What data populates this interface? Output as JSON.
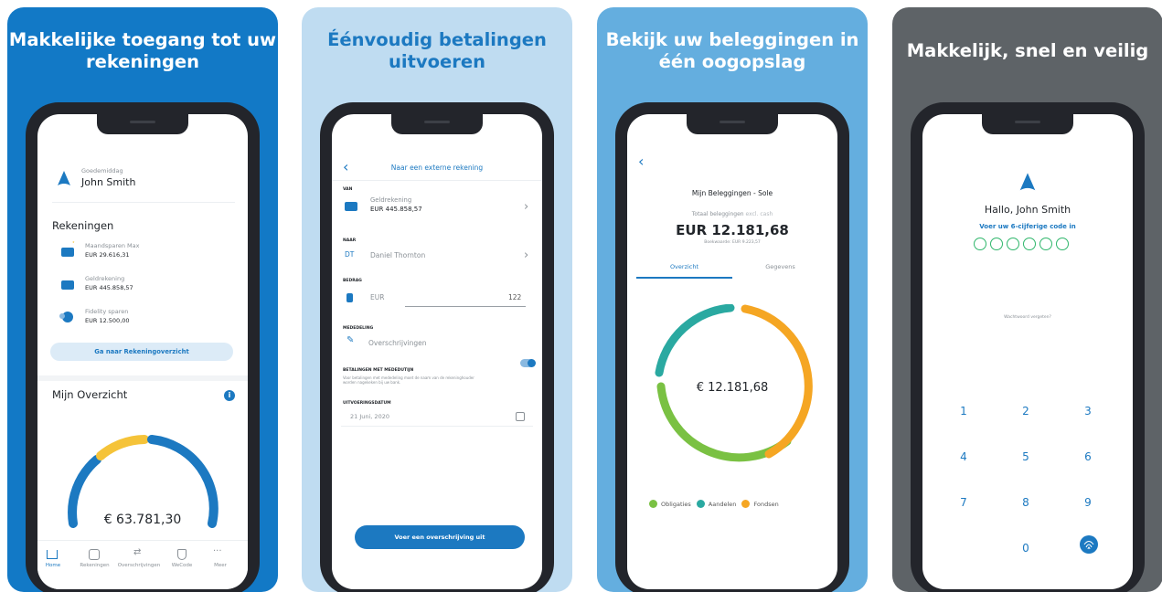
{
  "panel1": {
    "headline": "Makkelijke toegang tot uw rekeningen",
    "greeting": "Goedemiddag",
    "user_name": "John Smith",
    "accounts_title": "Rekeningen",
    "accounts": [
      {
        "name": "Maandsparen Max",
        "amount": "EUR 29.616,31"
      },
      {
        "name": "Geldrekening",
        "amount": "EUR 445.858,57"
      },
      {
        "name": "Fidelity sparen",
        "amount": "EUR 12.500,00"
      }
    ],
    "overview_button": "Ga naar Rekeningoverzicht",
    "overview_title": "Mijn Overzicht",
    "total": "€ 63.781,30",
    "tabs": [
      "Home",
      "Rekeningen",
      "Overschrijvingen",
      "WeCode",
      "Meer"
    ],
    "colors": {
      "panel": "#1279c6",
      "gauge_yellow": "#f5c339",
      "gauge_blue": "#1c79c1"
    }
  },
  "panel2": {
    "headline": "Éénvoudig betalingen uitvoeren",
    "nav_title": "Naar een externe rekening",
    "from_label": "VAN",
    "from_account": "Geldrekening",
    "from_amount": "EUR 445.858,57",
    "to_label": "NAAR",
    "to_initials": "DT",
    "to_name": "Daniel Thornton",
    "amount_label": "BEDRAG",
    "currency": "EUR",
    "amount_value": "122",
    "message_label": "MEDEDELING",
    "message_value": "Overschrijvingen",
    "toggle_label": "BETALINGEN MET MEDEDUTIJN",
    "toggle_desc": "Voor betalingen met mededeling moet de naam van de rekeninghouder worden nagekeken bij uw bank.",
    "date_label": "UITVOERINGSDATUM",
    "date_value": "21 Juni, 2020",
    "submit": "Voer een overschrijving uit"
  },
  "panel3": {
    "headline": "Bekijk uw beleggingen in één oogopslag",
    "title": "Mijn Beleggingen - Sole",
    "total_label": "Totaal beleggingen",
    "total_label_suffix": "excl. cash",
    "total_value": "EUR  12.181,68",
    "book_value": "Boekwaarde: EUR  9.223,57",
    "tabs": [
      "Overzicht",
      "Gegevens"
    ],
    "donut_center": "€ 12.181,68",
    "legend": [
      {
        "name": "Obligaties",
        "color": "#7ac143"
      },
      {
        "name": "Aandelen",
        "color": "#2aa9a1"
      },
      {
        "name": "Fondsen",
        "color": "#f5a623"
      }
    ]
  },
  "panel4": {
    "headline": "Makkelijk, snel en veilig",
    "greeting": "Hallo, John Smith",
    "prompt": "Voer uw 6-cijferige code in",
    "forgot": "Wachtwoord vergeten?",
    "keys": [
      "1",
      "2",
      "3",
      "4",
      "5",
      "6",
      "7",
      "8",
      "9",
      "0"
    ]
  }
}
